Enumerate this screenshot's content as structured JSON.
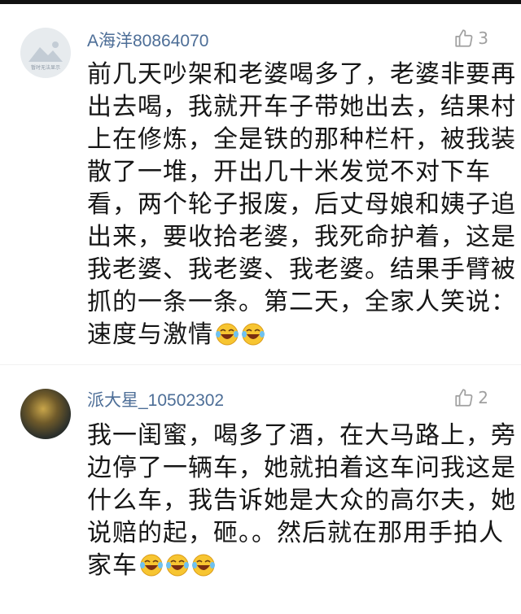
{
  "comments": [
    {
      "username": "A海洋80864070",
      "avatar_text": "暂时无法显示",
      "likes": "3",
      "lines": [
        "前几天吵架和老婆喝多了，老婆非要再",
        "出去喝，我就开车子带她出去，结果村",
        "上在修炼，全是铁的那种栏杆，被我装",
        "散了一堆，开出几十米发觉不对下车",
        "看，两个轮子报废，后丈母娘和姨子追",
        "出来，要收拾老婆，我死命护着，这是",
        "我老婆、我老婆、我老婆。结果手臂被",
        "抓的一条一条。第二天，全家人笑说：",
        "速度与激情"
      ],
      "emoji_count": 2
    },
    {
      "username": "派大星_10502302",
      "likes": "2",
      "lines": [
        "我一闺蜜，喝多了酒，在大马路上，旁",
        "边停了一辆车，她就拍着这车问我这是",
        "什么车，我告诉她是大众的高尔夫，她",
        "说赔的起，砸。。然后就在那用手拍人",
        "家车"
      ],
      "emoji_count": 3
    }
  ],
  "icons": {
    "like": "thumbs-up-icon",
    "emoji": "laughing-crying-emoji-icon"
  },
  "colors": {
    "username": "#4d6e97",
    "text": "#161616",
    "like": "#a0a0a0"
  }
}
